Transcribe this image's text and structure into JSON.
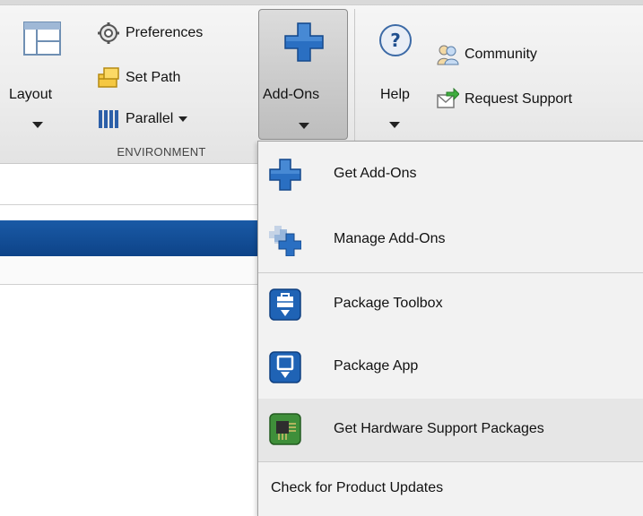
{
  "toolstrip": {
    "layout_label": "Layout",
    "preferences_label": "Preferences",
    "set_path_label": "Set Path",
    "parallel_label": "Parallel",
    "environment_section_label": "ENVIRONMENT",
    "addons_label": "Add-Ons",
    "help_label": "Help",
    "community_label": "Community",
    "request_support_label": "Request Support"
  },
  "addons_menu": {
    "items": [
      {
        "label": "Get Add-Ons",
        "icon": "plus-icon"
      },
      {
        "label": "Manage Add-Ons",
        "icon": "manage-addons-icon"
      },
      {
        "label": "Package Toolbox",
        "icon": "package-toolbox-icon"
      },
      {
        "label": "Package App",
        "icon": "package-app-icon"
      },
      {
        "label": "Get Hardware Support Packages",
        "icon": "circuit-board-icon"
      },
      {
        "label": "Check for Product Updates",
        "icon": ""
      }
    ]
  },
  "colors": {
    "accent_blue": "#1f63b5",
    "band_blue": "#0d4388",
    "menu_background": "#f2f2f2",
    "menu_highlight": "#e6e6e6"
  }
}
